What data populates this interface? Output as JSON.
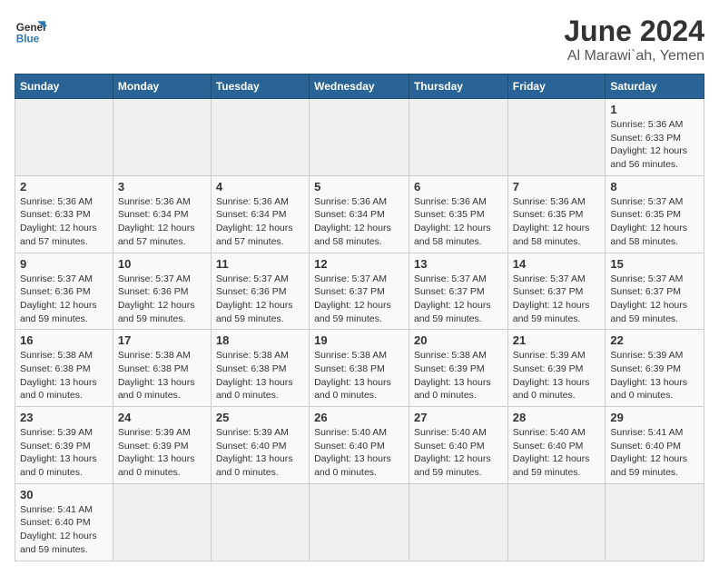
{
  "header": {
    "logo_general": "General",
    "logo_blue": "Blue",
    "month_title": "June 2024",
    "subtitle": "Al Marawi`ah, Yemen"
  },
  "columns": [
    "Sunday",
    "Monday",
    "Tuesday",
    "Wednesday",
    "Thursday",
    "Friday",
    "Saturday"
  ],
  "weeks": [
    [
      {
        "day": "",
        "info": ""
      },
      {
        "day": "",
        "info": ""
      },
      {
        "day": "",
        "info": ""
      },
      {
        "day": "",
        "info": ""
      },
      {
        "day": "",
        "info": ""
      },
      {
        "day": "",
        "info": ""
      },
      {
        "day": "1",
        "info": "Sunrise: 5:36 AM\nSunset: 6:33 PM\nDaylight: 12 hours and 56 minutes."
      }
    ],
    [
      {
        "day": "2",
        "info": "Sunrise: 5:36 AM\nSunset: 6:33 PM\nDaylight: 12 hours and 57 minutes."
      },
      {
        "day": "3",
        "info": "Sunrise: 5:36 AM\nSunset: 6:34 PM\nDaylight: 12 hours and 57 minutes."
      },
      {
        "day": "4",
        "info": "Sunrise: 5:36 AM\nSunset: 6:34 PM\nDaylight: 12 hours and 57 minutes."
      },
      {
        "day": "5",
        "info": "Sunrise: 5:36 AM\nSunset: 6:34 PM\nDaylight: 12 hours and 58 minutes."
      },
      {
        "day": "6",
        "info": "Sunrise: 5:36 AM\nSunset: 6:35 PM\nDaylight: 12 hours and 58 minutes."
      },
      {
        "day": "7",
        "info": "Sunrise: 5:36 AM\nSunset: 6:35 PM\nDaylight: 12 hours and 58 minutes."
      },
      {
        "day": "8",
        "info": "Sunrise: 5:37 AM\nSunset: 6:35 PM\nDaylight: 12 hours and 58 minutes."
      }
    ],
    [
      {
        "day": "9",
        "info": "Sunrise: 5:37 AM\nSunset: 6:36 PM\nDaylight: 12 hours and 59 minutes."
      },
      {
        "day": "10",
        "info": "Sunrise: 5:37 AM\nSunset: 6:36 PM\nDaylight: 12 hours and 59 minutes."
      },
      {
        "day": "11",
        "info": "Sunrise: 5:37 AM\nSunset: 6:36 PM\nDaylight: 12 hours and 59 minutes."
      },
      {
        "day": "12",
        "info": "Sunrise: 5:37 AM\nSunset: 6:37 PM\nDaylight: 12 hours and 59 minutes."
      },
      {
        "day": "13",
        "info": "Sunrise: 5:37 AM\nSunset: 6:37 PM\nDaylight: 12 hours and 59 minutes."
      },
      {
        "day": "14",
        "info": "Sunrise: 5:37 AM\nSunset: 6:37 PM\nDaylight: 12 hours and 59 minutes."
      },
      {
        "day": "15",
        "info": "Sunrise: 5:37 AM\nSunset: 6:37 PM\nDaylight: 12 hours and 59 minutes."
      }
    ],
    [
      {
        "day": "16",
        "info": "Sunrise: 5:38 AM\nSunset: 6:38 PM\nDaylight: 13 hours and 0 minutes."
      },
      {
        "day": "17",
        "info": "Sunrise: 5:38 AM\nSunset: 6:38 PM\nDaylight: 13 hours and 0 minutes."
      },
      {
        "day": "18",
        "info": "Sunrise: 5:38 AM\nSunset: 6:38 PM\nDaylight: 13 hours and 0 minutes."
      },
      {
        "day": "19",
        "info": "Sunrise: 5:38 AM\nSunset: 6:38 PM\nDaylight: 13 hours and 0 minutes."
      },
      {
        "day": "20",
        "info": "Sunrise: 5:38 AM\nSunset: 6:39 PM\nDaylight: 13 hours and 0 minutes."
      },
      {
        "day": "21",
        "info": "Sunrise: 5:39 AM\nSunset: 6:39 PM\nDaylight: 13 hours and 0 minutes."
      },
      {
        "day": "22",
        "info": "Sunrise: 5:39 AM\nSunset: 6:39 PM\nDaylight: 13 hours and 0 minutes."
      }
    ],
    [
      {
        "day": "23",
        "info": "Sunrise: 5:39 AM\nSunset: 6:39 PM\nDaylight: 13 hours and 0 minutes."
      },
      {
        "day": "24",
        "info": "Sunrise: 5:39 AM\nSunset: 6:39 PM\nDaylight: 13 hours and 0 minutes."
      },
      {
        "day": "25",
        "info": "Sunrise: 5:39 AM\nSunset: 6:40 PM\nDaylight: 13 hours and 0 minutes."
      },
      {
        "day": "26",
        "info": "Sunrise: 5:40 AM\nSunset: 6:40 PM\nDaylight: 13 hours and 0 minutes."
      },
      {
        "day": "27",
        "info": "Sunrise: 5:40 AM\nSunset: 6:40 PM\nDaylight: 12 hours and 59 minutes."
      },
      {
        "day": "28",
        "info": "Sunrise: 5:40 AM\nSunset: 6:40 PM\nDaylight: 12 hours and 59 minutes."
      },
      {
        "day": "29",
        "info": "Sunrise: 5:41 AM\nSunset: 6:40 PM\nDaylight: 12 hours and 59 minutes."
      }
    ],
    [
      {
        "day": "30",
        "info": "Sunrise: 5:41 AM\nSunset: 6:40 PM\nDaylight: 12 hours and 59 minutes."
      },
      {
        "day": "",
        "info": ""
      },
      {
        "day": "",
        "info": ""
      },
      {
        "day": "",
        "info": ""
      },
      {
        "day": "",
        "info": ""
      },
      {
        "day": "",
        "info": ""
      },
      {
        "day": "",
        "info": ""
      }
    ]
  ]
}
